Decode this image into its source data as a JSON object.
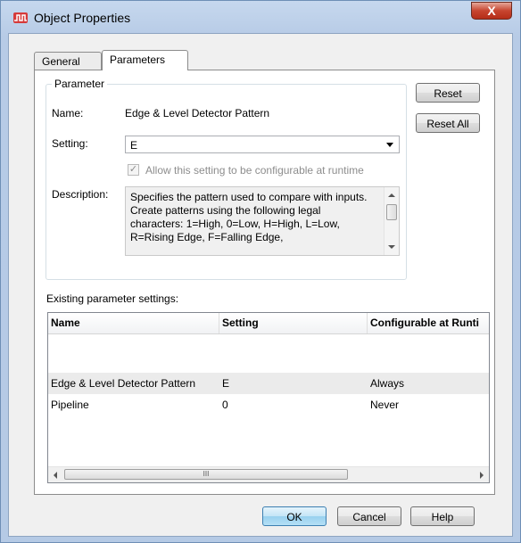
{
  "window": {
    "title": "Object Properties",
    "close_label": "X"
  },
  "tabs": [
    {
      "label": "General",
      "active": false
    },
    {
      "label": "Parameters",
      "active": true
    }
  ],
  "parameter": {
    "group_label": "Parameter",
    "name_label": "Name:",
    "name_value": "Edge & Level Detector Pattern",
    "setting_label": "Setting:",
    "setting_value": "E",
    "runtime_checkbox_label": "Allow this setting to be configurable at runtime",
    "runtime_checked": true,
    "description_label": "Description:",
    "description_text": "Specifies the pattern used to compare with inputs. Create patterns using the following legal characters: 1=High, 0=Low, H=High, L=Low, R=Rising Edge, F=Falling Edge,"
  },
  "buttons": {
    "reset": "Reset",
    "reset_all": "Reset All",
    "ok": "OK",
    "cancel": "Cancel",
    "help": "Help"
  },
  "existing": {
    "label": "Existing parameter settings:",
    "columns": [
      "Name",
      "Setting",
      "Configurable at Runti"
    ],
    "rows": [
      {
        "name": "Edge & Level Detector Pattern",
        "setting": "E",
        "configurable": "Always",
        "selected": true
      },
      {
        "name": "Pipeline",
        "setting": "0",
        "configurable": "Never",
        "selected": false
      }
    ],
    "scroll_thumb_grip": "III"
  }
}
